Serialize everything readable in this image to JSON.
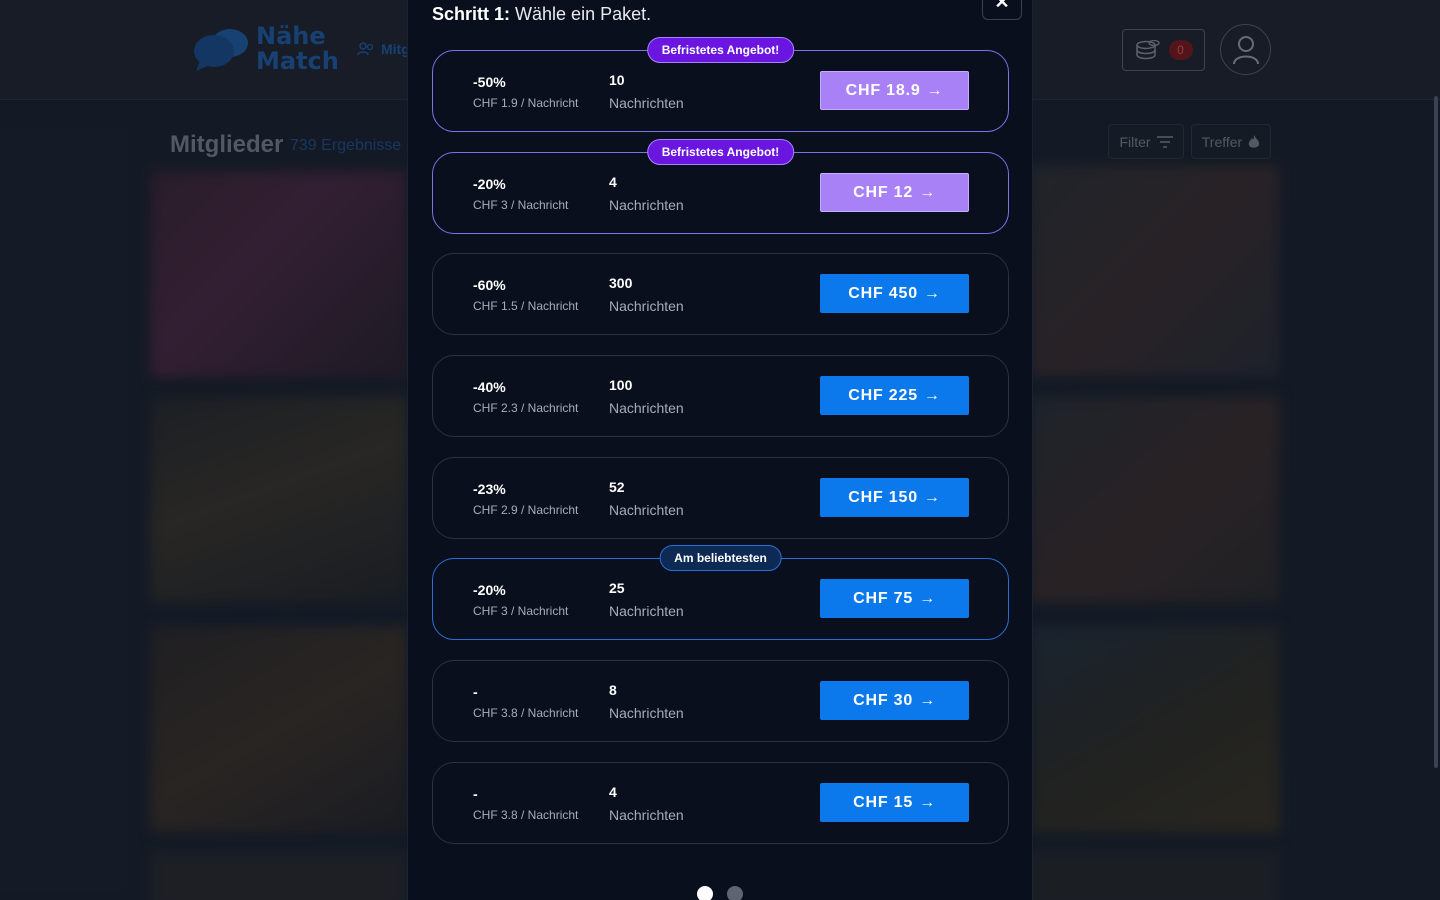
{
  "header": {
    "logo_line1": "Nähe",
    "logo_line2": "Match",
    "nav_members_label": "Mitg",
    "coins_count": "0"
  },
  "members": {
    "title": "Mitglieder",
    "count": "739 Ergebnisse",
    "filter_label": "Filter",
    "matches_label": "Treffer"
  },
  "modal": {
    "step_label": "Schritt 1:",
    "step_text": "Wähle ein Paket.",
    "close_symbol": "✕",
    "packages": [
      {
        "tag": "Befristetes Angebot!",
        "discount": "-50%",
        "per_message": "CHF 1.9 / Nachricht",
        "quantity": "10",
        "unit": "Nachrichten",
        "price": "CHF 18.9",
        "arrow": "→"
      },
      {
        "tag": "Befristetes Angebot!",
        "discount": "-20%",
        "per_message": "CHF 3 / Nachricht",
        "quantity": "4",
        "unit": "Nachrichten",
        "price": "CHF 12",
        "arrow": "→"
      },
      {
        "tag": "",
        "discount": "-60%",
        "per_message": "CHF 1.5 / Nachricht",
        "quantity": "300",
        "unit": "Nachrichten",
        "price": "CHF 450",
        "arrow": "→"
      },
      {
        "tag": "",
        "discount": "-40%",
        "per_message": "CHF 2.3 / Nachricht",
        "quantity": "100",
        "unit": "Nachrichten",
        "price": "CHF 225",
        "arrow": "→"
      },
      {
        "tag": "",
        "discount": "-23%",
        "per_message": "CHF 2.9 / Nachricht",
        "quantity": "52",
        "unit": "Nachrichten",
        "price": "CHF 150",
        "arrow": "→"
      },
      {
        "tag": "Am beliebtesten",
        "discount": "-20%",
        "per_message": "CHF 3 / Nachricht",
        "quantity": "25",
        "unit": "Nachrichten",
        "price": "CHF 75",
        "arrow": "→"
      },
      {
        "tag": "",
        "discount": "-",
        "per_message": "CHF 3.8 / Nachricht",
        "quantity": "8",
        "unit": "Nachrichten",
        "price": "CHF 30",
        "arrow": "→"
      },
      {
        "tag": "",
        "discount": "-",
        "per_message": "CHF 3.8 / Nachricht",
        "quantity": "4",
        "unit": "Nachrichten",
        "price": "CHF 15",
        "arrow": "→"
      }
    ],
    "pagination": {
      "current_page": 1,
      "total_pages": 2
    }
  },
  "colors": {
    "primary_button": "#0b78ec",
    "limited_offer_button": "#a881f6",
    "limited_offer_tag": "#6a16e0",
    "popular_tag": "#0d2a55",
    "modal_background": "#0a0f1d"
  },
  "icons": {
    "logo": "speech-bubbles-icon",
    "nav_members": "users-icon",
    "coins": "coins-stack-icon",
    "profile": "user-icon",
    "filter": "filter-lines-icon",
    "matches": "flame-icon",
    "close": "close-icon"
  }
}
